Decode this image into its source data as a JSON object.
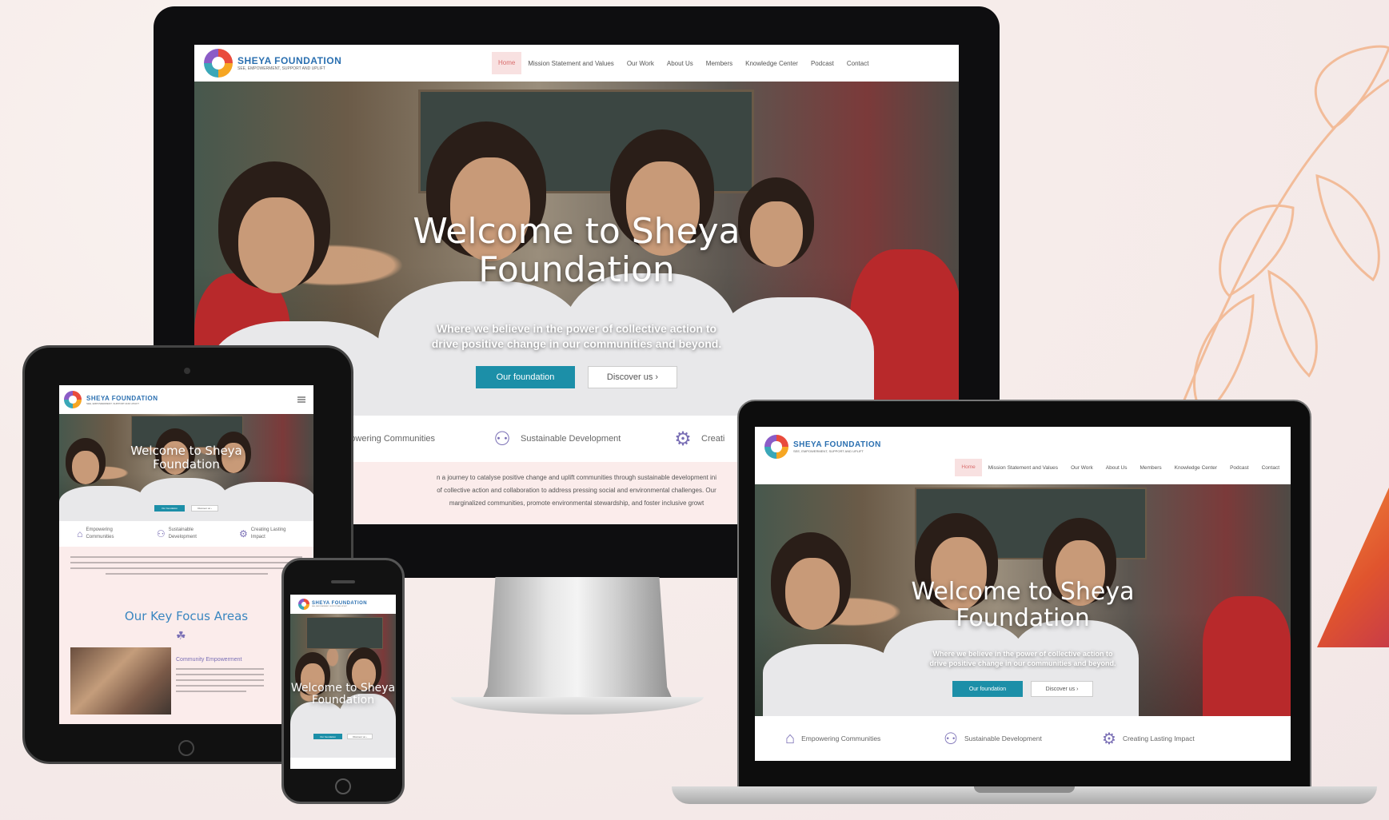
{
  "brand": {
    "name": "SHEYA FOUNDATION",
    "tagline": "SEE, EMPOWERMENT, SUPPORT AND UPLIFT"
  },
  "nav": {
    "items": [
      "Home",
      "Mission Statement and Values",
      "Our Work",
      "About Us",
      "Members",
      "Knowledge Center",
      "Podcast",
      "Contact"
    ],
    "active": "Home"
  },
  "hero": {
    "title_line1": "Welcome to Sheya",
    "title_line2": "Foundation",
    "subtitle_line1": "Where we believe in the power of collective action to",
    "subtitle_line2": "drive positive change in our communities and beyond.",
    "primary_button": "Our foundation",
    "secondary_button": "Discover us ›"
  },
  "features": {
    "items": [
      "Empowering Communities",
      "Sustainable Development",
      "Creating Lasting Impact"
    ],
    "monitor_visible": [
      "mpowering Communities",
      "Sustainable Development",
      "Creati"
    ]
  },
  "about": {
    "line1": "n a journey to catalyse positive change and uplift communities through sustainable development ini",
    "line2": "of collective action and collaboration to address pressing social and environmental challenges. Our",
    "line3": "marginalized communities, promote environmental stewardship, and foster inclusive growt"
  },
  "tablet": {
    "features": [
      "Empowering\nCommunities",
      "Sustainable\nDevelopment",
      "Creating Lasting\nImpact"
    ],
    "focus_title": "Our Key Focus Areas",
    "focus_item": "Community Empowerment"
  },
  "colors": {
    "accent": "#1c8fa8",
    "brand_blue": "#2a6fb0",
    "nav_active_bg": "#f8e1e1",
    "about_band": "#fbeceb",
    "decor_orange": "#f0a070"
  },
  "icons": {
    "feature_1": "community-building-icon",
    "feature_2": "people-network-icon",
    "feature_3": "gear-impact-icon"
  }
}
